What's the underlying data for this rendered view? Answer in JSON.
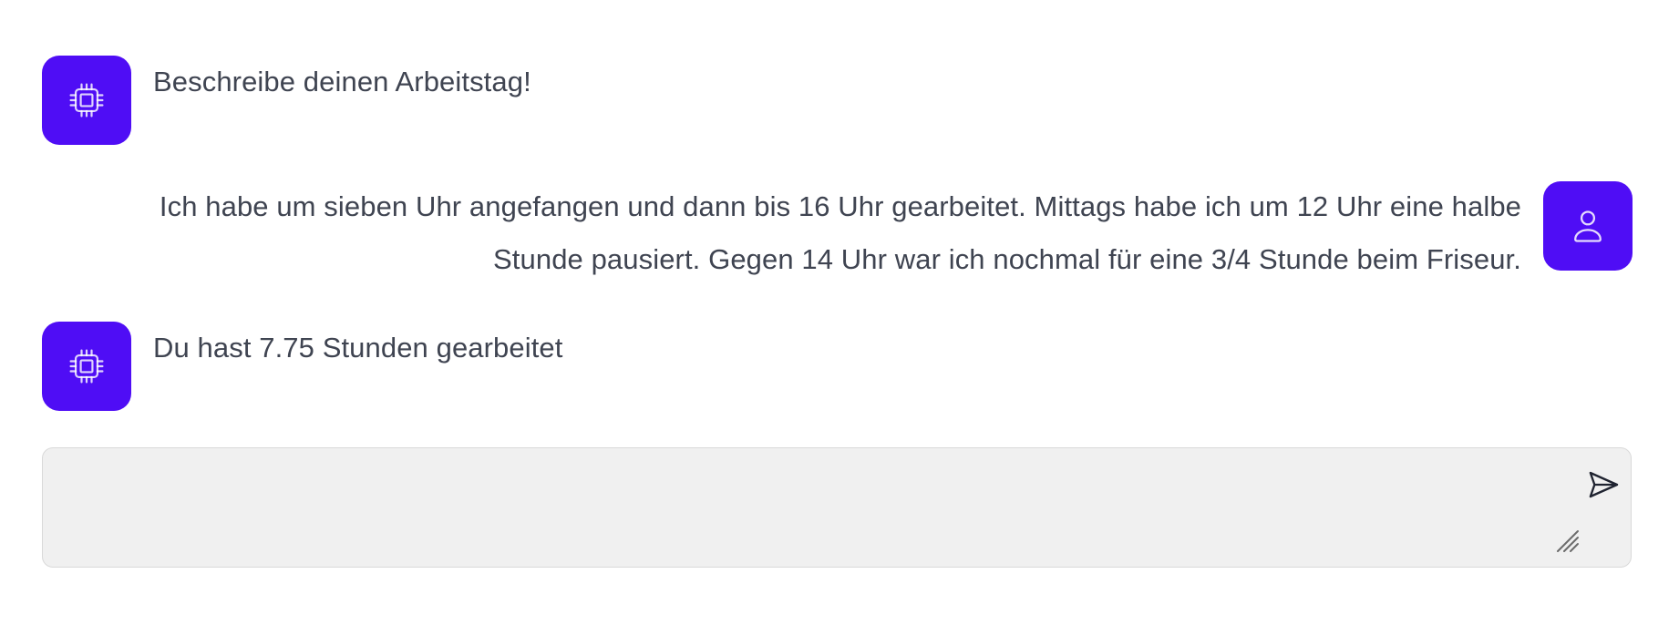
{
  "conversation": {
    "messages": [
      {
        "role": "assistant",
        "avatar_icon": "cpu-chip-icon",
        "text": "Beschreibe deinen Arbeitstag!"
      },
      {
        "role": "user",
        "avatar_icon": "user-icon",
        "text_line_1": "Ich habe um sieben Uhr angefangen und dann bis 16 Uhr gearbeitet. Mittags habe ich um 12 Uhr eine halbe",
        "text_line_2": "Stunde pausiert. Gegen 14 Uhr war ich nochmal für eine 3/4 Stunde beim Friseur."
      },
      {
        "role": "assistant",
        "avatar_icon": "cpu-chip-icon",
        "text": "Du hast 7.75 Stunden gearbeitet"
      }
    ]
  },
  "composer": {
    "value": "",
    "send_icon": "paper-plane-icon",
    "resize_icon": "resize-grip-icon"
  },
  "colors": {
    "avatar_bg": "#4f0df5",
    "text": "#3f4451",
    "composer_bg": "#f0f0f0",
    "composer_border": "#d9d9d9"
  }
}
